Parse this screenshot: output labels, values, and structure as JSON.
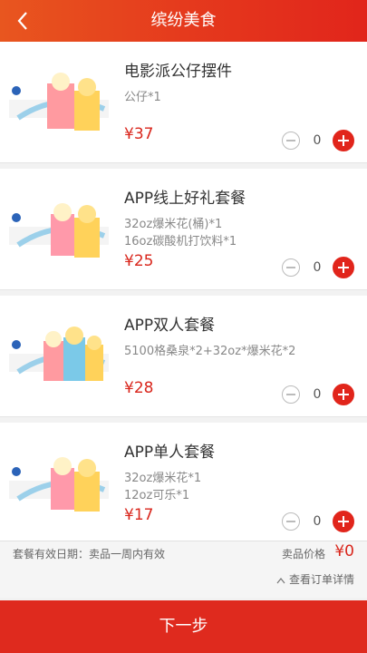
{
  "header": {
    "title": "缤纷美食",
    "back_icon": "chevron-left-icon"
  },
  "items": [
    {
      "name": "电影派公仔摆件",
      "desc": "公仔*1",
      "price": "¥37",
      "qty": "0"
    },
    {
      "name": "APP线上好礼套餐",
      "desc": "32oz爆米花(桶)*1\n16oz碳酸机打饮料*1",
      "price": "¥25",
      "qty": "0"
    },
    {
      "name": "APP双人套餐",
      "desc": "5100格桑泉*2+32oz*爆米花*2",
      "price": "¥28",
      "qty": "0"
    },
    {
      "name": "APP单人套餐",
      "desc": "32oz爆米花*1\n12oz可乐*1",
      "price": "¥17",
      "qty": "0"
    }
  ],
  "footer": {
    "valid_text": "套餐有效日期：卖品一周内有效",
    "sale_price_label": "卖品价格",
    "sale_price_value": "¥0",
    "detail_link": "查看订单详情",
    "next_button": "下一步"
  },
  "colors": {
    "accent": "#e1251b",
    "price": "#d9261c",
    "header_left": "#e8561f"
  }
}
